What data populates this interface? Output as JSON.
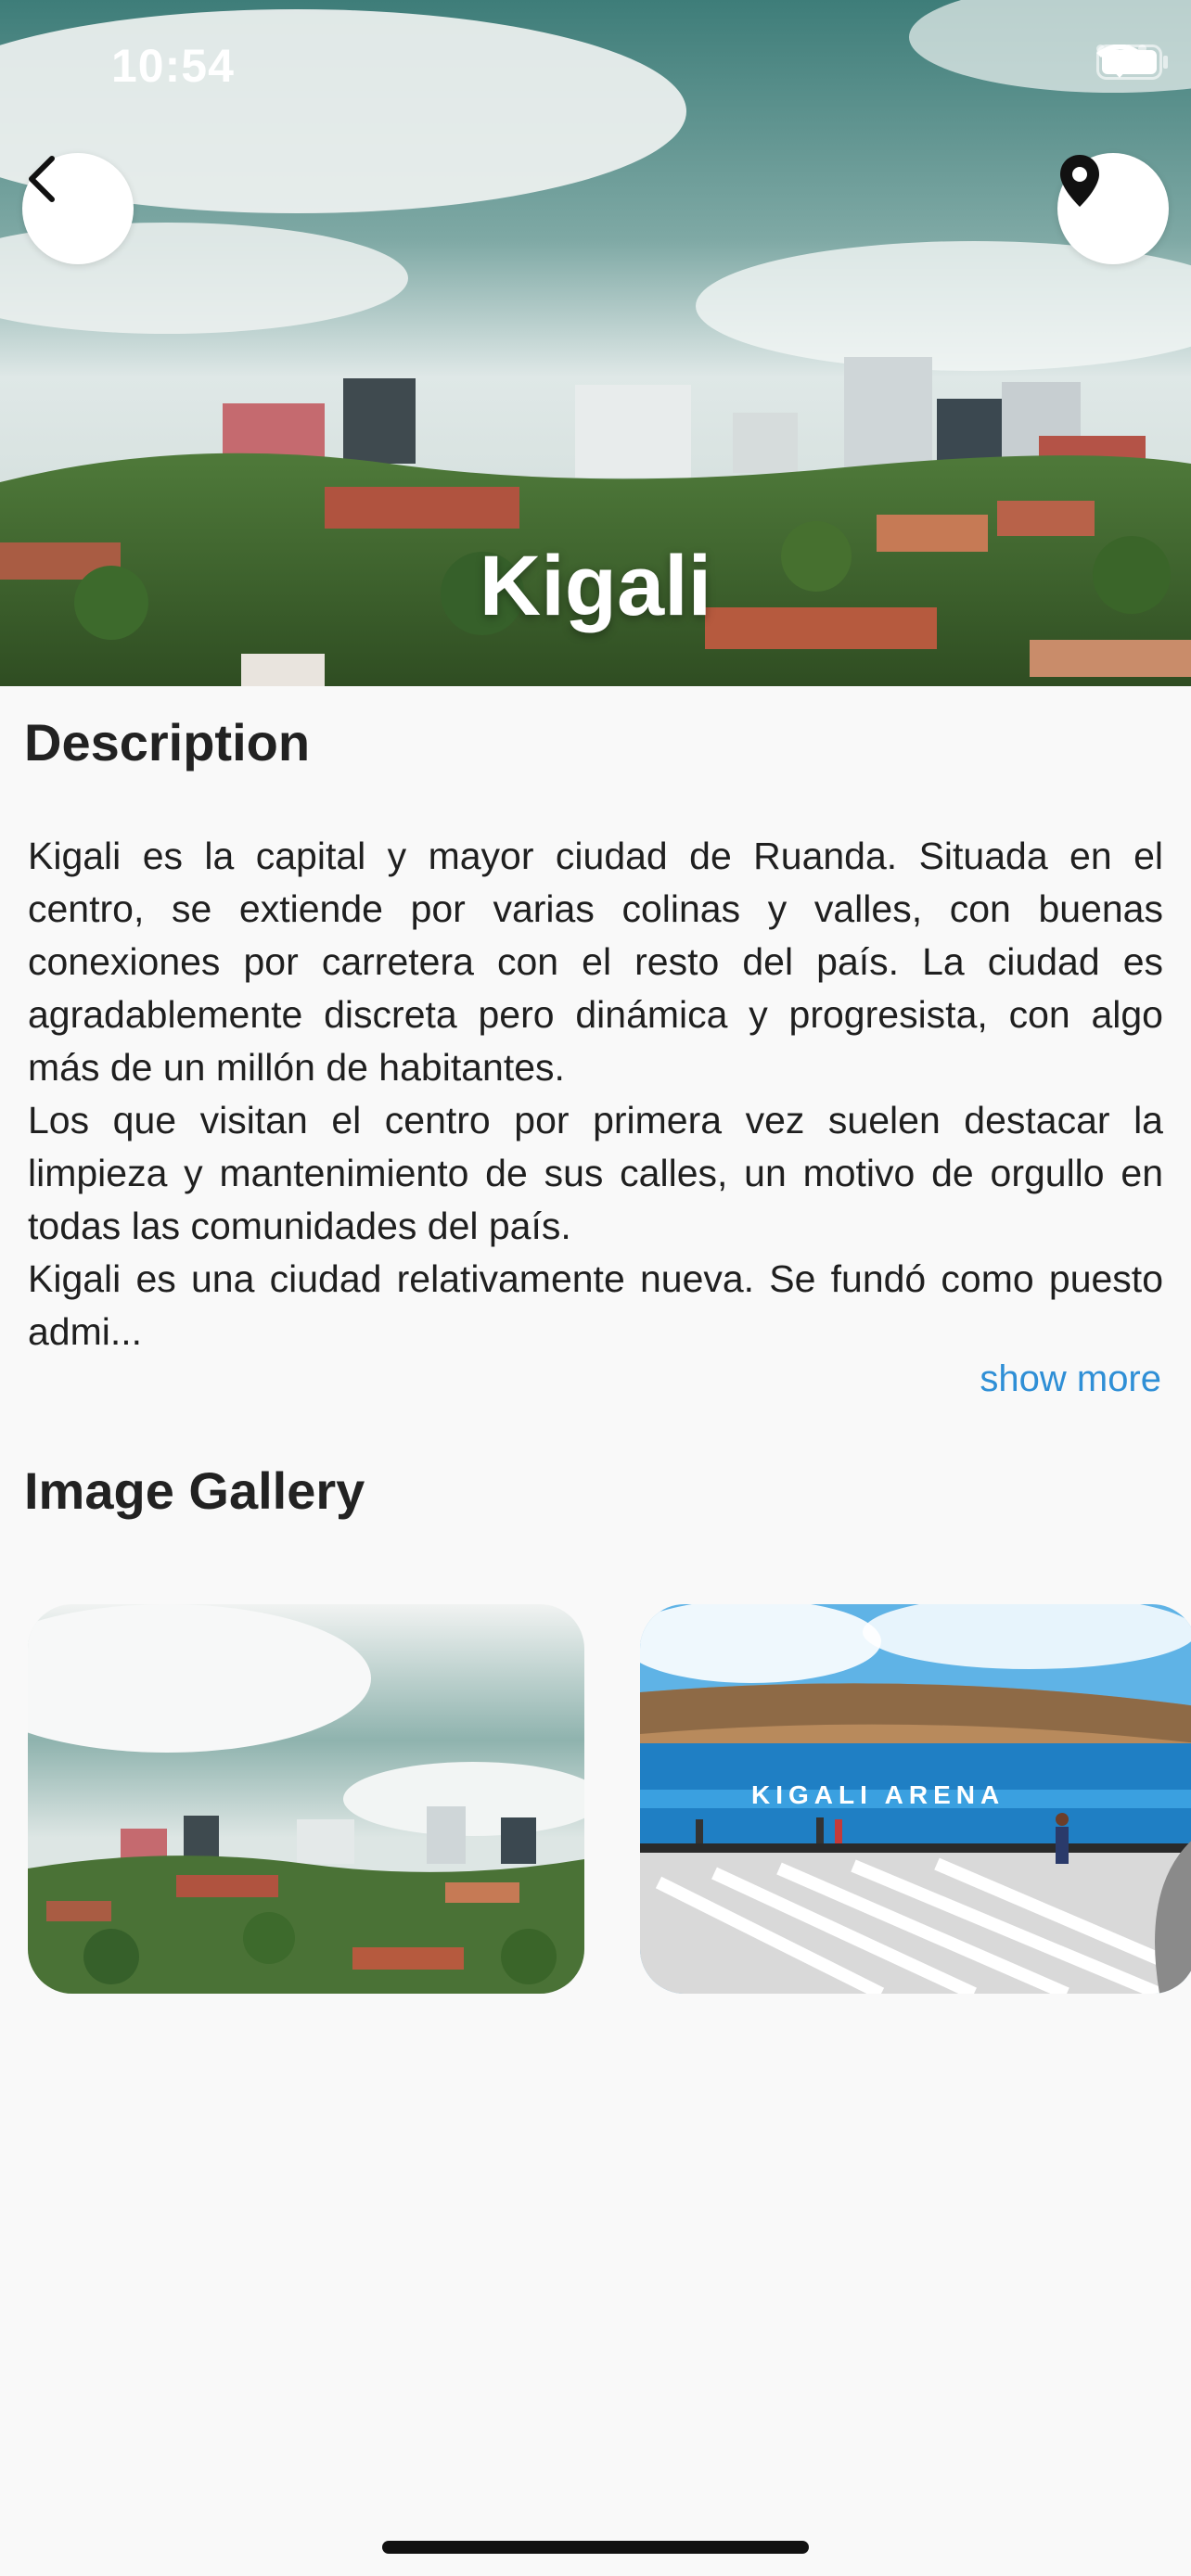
{
  "status_bar": {
    "time": "10:54",
    "icons": [
      "cellular-signal-icon",
      "wifi-icon",
      "battery-icon"
    ]
  },
  "hero": {
    "title": "Kigali",
    "back_icon": "chevron-left-icon",
    "location_icon": "map-pin-icon"
  },
  "description": {
    "heading": "Description",
    "text": "Kigali es la capital y mayor ciudad de Ruanda. Situada en el centro, se extiende por varias colinas y valles, con buenas conexiones por carretera con el resto del país. La ciudad es agradablemente discreta pero dinámica y progresista, con algo más de un millón de habitantes.\nLos que visitan el centro por primera vez suelen destacar la limpieza y mantenimiento de sus calles, un motivo de orgullo en todas las comunidades del país.\nKigali es una ciudad relativamente nueva. Se fundó como puesto admi...",
    "show_more_label": "show more"
  },
  "gallery": {
    "heading": "Image Gallery",
    "image_2_sign": "KIGALI ARENA"
  },
  "colors": {
    "background": "#f9f9f9",
    "link": "#2f8fd6",
    "heading": "#222222"
  }
}
